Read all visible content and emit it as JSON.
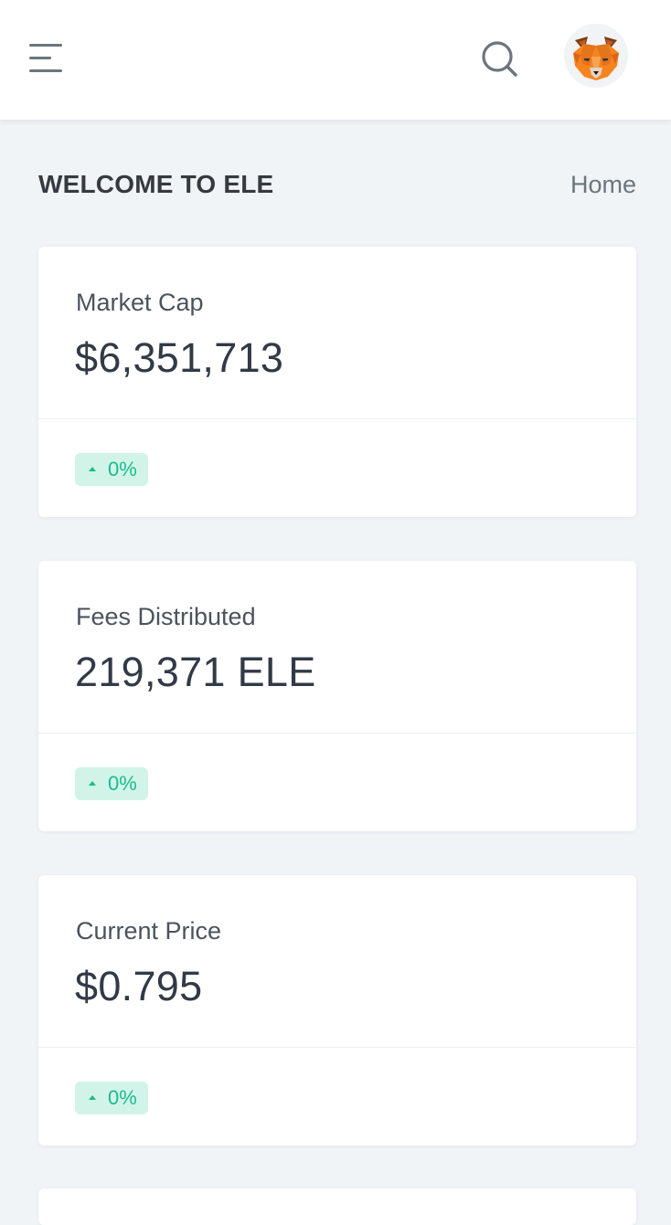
{
  "header": {
    "menu_icon": "hamburger-menu-icon",
    "search_icon": "search-icon",
    "avatar_icon": "metamask-fox-icon"
  },
  "page": {
    "title": "WELCOME TO ELE",
    "breadcrumb": "Home"
  },
  "cards": [
    {
      "label": "Market Cap",
      "value": "$6,351,713",
      "change": "0%",
      "trend": "up"
    },
    {
      "label": "Fees Distributed",
      "value": "219,371 ELE",
      "change": "0%",
      "trend": "up"
    },
    {
      "label": "Current Price",
      "value": "$0.795",
      "change": "0%",
      "trend": "up"
    }
  ],
  "colors": {
    "background": "#f0f4f7",
    "card": "#ffffff",
    "text": "#313a46",
    "muted": "#6c757d",
    "success": "#1abc8c",
    "success_bg": "#d2f4e8",
    "fox_orange": "#f5841f"
  }
}
